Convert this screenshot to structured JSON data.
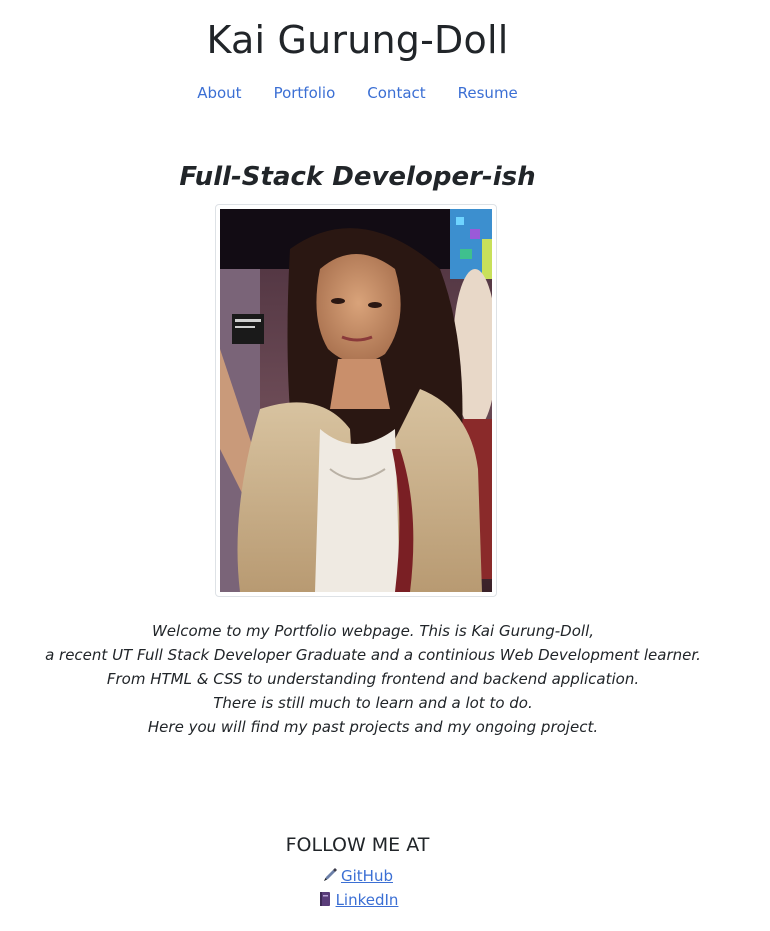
{
  "header": {
    "title": "Kai Gurung-Doll",
    "nav": [
      {
        "label": "About"
      },
      {
        "label": "Portfolio"
      },
      {
        "label": "Contact"
      },
      {
        "label": "Resume"
      }
    ]
  },
  "hero": {
    "tagline": "Full-Stack Developer-ish",
    "photo_icon": "profile-photo",
    "intro_lines": [
      "Welcome to my Portfolio webpage. This is Kai Gurung-Doll,",
      "a recent UT Full Stack Developer Graduate and a continious Web Development learner.",
      "From HTML & CSS to understanding frontend and backend application.",
      "There is still much to learn and a lot to do.",
      "Here you will find my past projects and my ongoing project."
    ]
  },
  "follow": {
    "heading": "FOLLOW ME AT",
    "links": [
      {
        "label": "GitHub",
        "icon": "pen-icon"
      },
      {
        "label": "LinkedIn",
        "icon": "book-icon"
      }
    ]
  },
  "colors": {
    "link": "#3b6fd4",
    "text": "#212529"
  }
}
